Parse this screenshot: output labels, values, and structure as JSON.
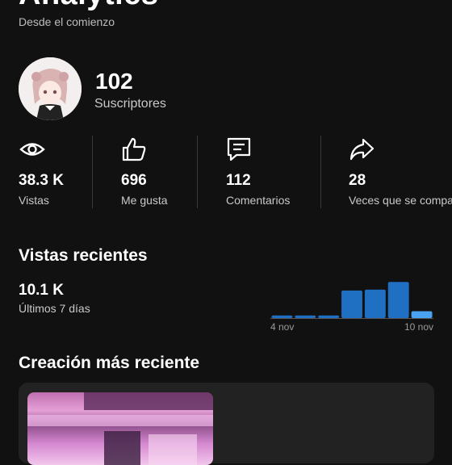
{
  "header": {
    "title": "Analytics",
    "subtitle": "Desde el comienzo"
  },
  "channel": {
    "subscribers_count": "102",
    "subscribers_label": "Suscriptores"
  },
  "stats": [
    {
      "icon": "eye-icon",
      "value": "38.3 K",
      "label": "Vistas"
    },
    {
      "icon": "thumbs-up-icon",
      "value": "696",
      "label": "Me gusta"
    },
    {
      "icon": "comment-icon",
      "value": "112",
      "label": "Comentarios"
    },
    {
      "icon": "share-icon",
      "value": "28",
      "label": "Veces que se compartió"
    }
  ],
  "recent_views": {
    "title": "Vistas recientes",
    "value": "10.1 K",
    "period": "Últimos 7 días",
    "colors": {
      "normal": "#1f6fc2",
      "highlight": "#4aa3f0",
      "axis": "#555555"
    }
  },
  "chart_data": {
    "type": "bar",
    "categories": [
      "4 nov",
      "5 nov",
      "6 nov",
      "7 nov",
      "8 nov",
      "9 nov",
      "10 nov"
    ],
    "values": [
      0.3,
      0.3,
      0.3,
      3.2,
      3.3,
      4.2,
      0.8
    ],
    "tick_labels": [
      "4 nov",
      "10 nov"
    ],
    "ylim": [
      0,
      4.5
    ]
  },
  "latest_creation": {
    "title": "Creación más reciente"
  }
}
